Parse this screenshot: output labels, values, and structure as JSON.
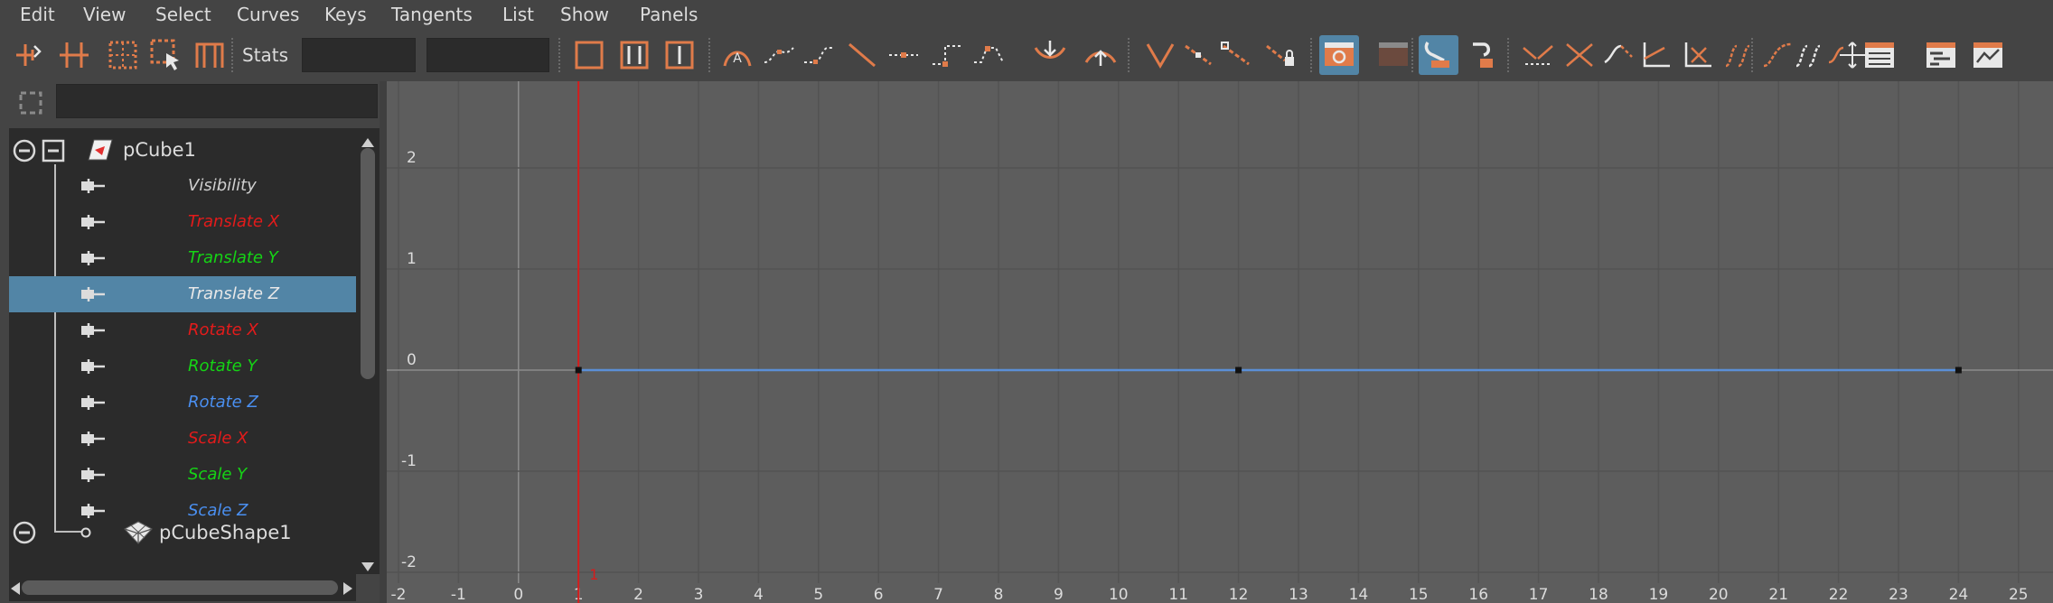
{
  "menubar": {
    "items": [
      "Edit",
      "View",
      "Select",
      "Curves",
      "Keys",
      "Tangents",
      "List",
      "Show",
      "Panels"
    ]
  },
  "toolbar": {
    "stats_label": "Stats",
    "stats_value_1": "",
    "stats_value_2": "",
    "accent_color": "#e07b4a",
    "active_color": "#5285a6",
    "icons": [
      "move-nearest-picked-key-icon",
      "insert-keys-icon",
      "lattice-deform-keys-icon",
      "region-tool-icon",
      "retime-tool-icon",
      "frame-all-icon",
      "frame-playback-range-icon",
      "center-current-time-icon",
      "auto-tangent-icon",
      "spline-tangent-icon",
      "clamped-tangent-icon",
      "linear-tangent-icon",
      "flat-tangent-icon",
      "step-tangent-icon",
      "plateau-tangent-icon",
      "default-in-tangent-icon",
      "default-out-tangent-icon",
      "break-tangents-icon",
      "unify-tangents-icon",
      "free-tangent-weight-icon",
      "lock-tangent-weight-icon",
      "auto-load-selected-icon",
      "load-selected-objects-icon",
      "time-snap-icon",
      "value-snap-icon",
      "normalize-curves-icon",
      "denormalize-curves-icon",
      "pre-infinity-cycle-icon",
      "pre-infinity-cycle-offset-icon",
      "post-infinity-cycle-icon",
      "post-infinity-cycle-offset-icon",
      "curve-buffer-icon",
      "swap-buffer-icon",
      "spreadsheet-icon",
      "dope-sheet-icon",
      "open-trax-icon",
      "graph-editor-settings-icon"
    ]
  },
  "outliner": {
    "filter_text": "",
    "root": {
      "label": "pCube1"
    },
    "channels": [
      {
        "label": "Visibility",
        "color": "#cfcfcf"
      },
      {
        "label": "Translate X",
        "color": "#e31b1b"
      },
      {
        "label": "Translate Y",
        "color": "#15d415"
      },
      {
        "label": "Translate Z",
        "color": "#e8e8e8",
        "selected": true
      },
      {
        "label": "Rotate X",
        "color": "#e31b1b"
      },
      {
        "label": "Rotate Y",
        "color": "#15d415"
      },
      {
        "label": "Rotate Z",
        "color": "#4a8ff0"
      },
      {
        "label": "Scale X",
        "color": "#e31b1b"
      },
      {
        "label": "Scale Y",
        "color": "#15d415"
      },
      {
        "label": "Scale Z",
        "color": "#4a8ff0"
      }
    ],
    "shape": {
      "label": "pCubeShape1"
    },
    "selected_color": "#5285a6"
  },
  "graph": {
    "x_ticks": [
      "-2",
      "-1",
      "0",
      "1",
      "2",
      "3",
      "4",
      "5",
      "6",
      "7",
      "8",
      "9",
      "10",
      "11",
      "12",
      "13",
      "14",
      "15",
      "16",
      "17",
      "18",
      "19",
      "20",
      "21",
      "22",
      "23",
      "24",
      "25"
    ],
    "y_ticks": [
      "2",
      "1",
      "0",
      "-1",
      "-2"
    ],
    "current_frame": "1",
    "current_time_color": "#d61c1c",
    "curve_color": "#5b8fd6",
    "curve": {
      "name": "Translate Z",
      "keys": [
        {
          "frame": 1,
          "value": 0
        },
        {
          "frame": 12,
          "value": 0
        },
        {
          "frame": 24,
          "value": 0
        }
      ]
    }
  }
}
